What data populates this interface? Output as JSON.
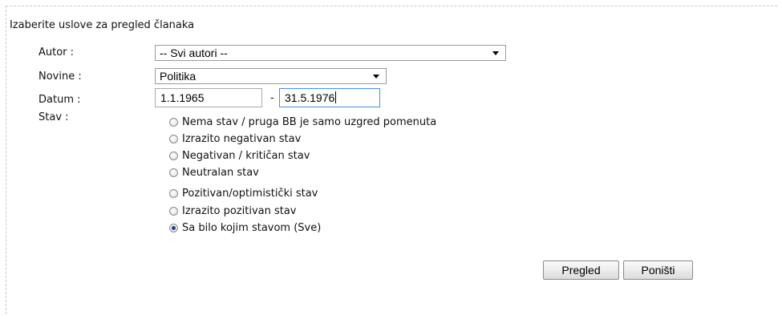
{
  "form": {
    "heading": "Izaberite uslove za pregled članaka",
    "autor": {
      "label": "Autor :",
      "value": "-- Svi autori --"
    },
    "novine": {
      "label": "Novine :",
      "value": "Politika"
    },
    "datum": {
      "label": "Datum :",
      "from": "1.1.1965",
      "separator": "-",
      "to": "31.5.1976"
    },
    "stav": {
      "label": "Stav :",
      "options": [
        {
          "label": "Nema stav / pruga BB je samo uzgred pomenuta",
          "checked": false
        },
        {
          "label": "Izrazito negativan stav",
          "checked": false
        },
        {
          "label": "Negativan / kritičan stav",
          "checked": false
        },
        {
          "label": "Neutralan stav",
          "checked": false
        },
        {
          "label": "Pozitivan/optimistički stav",
          "checked": false
        },
        {
          "label": "Izrazito pozitivan stav",
          "checked": false
        },
        {
          "label": "Sa bilo kojim stavom (Sve)",
          "checked": true
        }
      ]
    },
    "buttons": {
      "pregled": "Pregled",
      "ponisti": "Poništi"
    }
  }
}
